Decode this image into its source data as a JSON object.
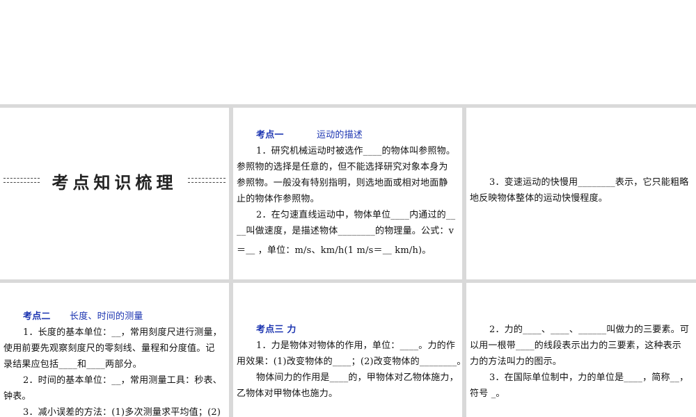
{
  "title": "考点知识梳理",
  "p1": {
    "heading": "考点一",
    "heading2": "运动的描述",
    "lines": [
      "1．研究机械运动时被选作____的物体叫参照物。",
      "参照物的选择是任意的，但不能选择研究对象本身为",
      "参照物。一般没有特别指明，则选地面或相对地面静",
      "止的物体作参照物。",
      "2．在匀速直线运动中，物体单位____内通过的__",
      "__叫做速度，是描述物体________的物理量。公式：v",
      "＝＿ ，单位：m/s、km/h(1 m/s＝＿ km/h)。"
    ]
  },
  "p2": {
    "lines": [
      "3．变速运动的快慢用________表示，它只能粗略",
      "地反映物体整体的运动快慢程度。"
    ]
  },
  "p3": {
    "heading": "考点二",
    "heading2": "长度、时间的测量",
    "lines": [
      "1．长度的基本单位：__，常用刻度尺进行测量，",
      "使用前要先观察刻度尺的零刻线、量程和分度值。记",
      "录结果应包括____和____两部分。",
      "2．时间的基本单位：__，常用测量工具：秒表、",
      "钟表。",
      "3．减小误差的方法：(1)多次测量求平均值；(2)"
    ]
  },
  "p4": {
    "heading": "考点三  力",
    "lines": [
      "1．力是物体对物体的作用，单位：____。力的作",
      "用效果：(1)改变物体的____；(2)改变物体的________。",
      "物体间力的作用是____的，甲物体对乙物体施力，",
      "乙物体对甲物体也施力。"
    ]
  },
  "p5": {
    "lines": [
      "2．力的____、____、______叫做力的三要素。可",
      "以用一根带____的线段表示出力的三要素，这种表示",
      "力的方法叫力的图示。",
      "3．在国际单位制中，力的单位是____，简称__，",
      "符号 _。"
    ]
  }
}
